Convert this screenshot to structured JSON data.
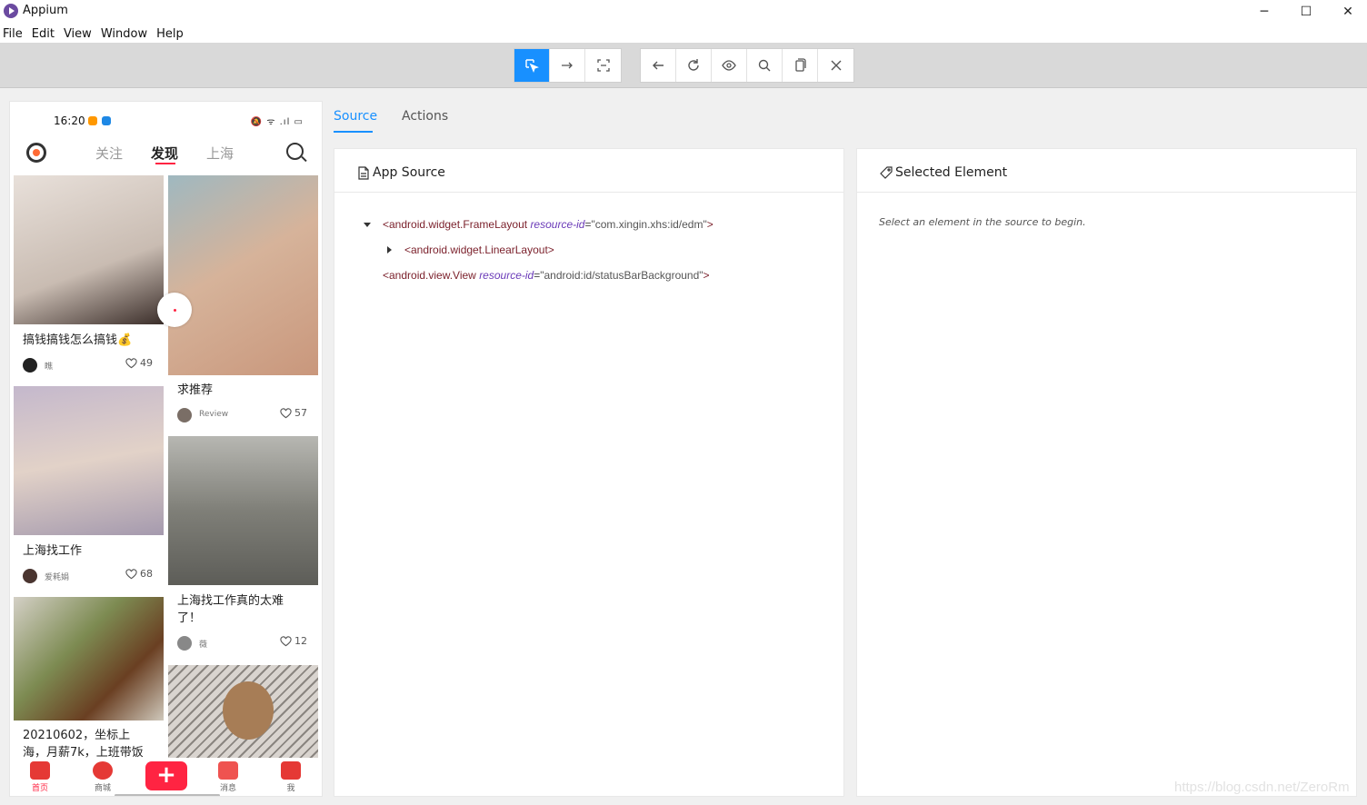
{
  "window": {
    "title": "Appium",
    "controls": [
      "─",
      "☐",
      "✕"
    ]
  },
  "menu": [
    "File",
    "Edit",
    "View",
    "Window",
    "Help"
  ],
  "toolbar": {
    "group1": [
      {
        "icon": "select-cursor-icon",
        "active": true
      },
      {
        "icon": "swipe-arrow-icon",
        "active": false
      },
      {
        "icon": "tap-area-icon",
        "active": false
      }
    ],
    "group2": [
      {
        "icon": "back-arrow-icon"
      },
      {
        "icon": "refresh-icon"
      },
      {
        "icon": "eye-icon"
      },
      {
        "icon": "search-icon"
      },
      {
        "icon": "copy-icon"
      },
      {
        "icon": "close-icon"
      }
    ]
  },
  "phone": {
    "status_time": "16:20",
    "status_dot_colors": [
      "#ff9800",
      "#1e88e5"
    ],
    "status_icons": "🔕 ᯤ .ıl ▭",
    "tabs": [
      "关注",
      "发现",
      "上海"
    ],
    "active_tab": "发现",
    "cards": [
      {
        "title": "搞钱搞钱怎么搞钱💰",
        "author": "瞧",
        "likes": "49",
        "image_color": "#d9cfc8",
        "avatar_color": "#222"
      },
      {
        "title": "求推荐",
        "author": "Review",
        "likes": "57",
        "image_color": "#c9a58b",
        "avatar_color": "#7a6e66"
      },
      {
        "title": "上海找工作",
        "author": "爱耗娟",
        "likes": "68",
        "image_color": "#a79fb0",
        "avatar_color": "#4a3530"
      },
      {
        "title": "上海找工作真的太难了！",
        "title_line1": "上海找工作真的太难",
        "title_line2": "了！",
        "author": "薇",
        "likes": "12",
        "image_color": "#8a8880",
        "avatar_color": "#888"
      },
      {
        "title": "20210602，坐标上海，月薪7k，上班带饭",
        "title_line1": "20210602，坐标上",
        "title_line2": "海，月薪7k，上班带饭",
        "image_color": "#7d8b52"
      },
      {
        "title": "",
        "image_color": "#cbc2b8"
      }
    ],
    "bottom_nav": [
      {
        "label": "首页",
        "icon": "home-icon",
        "active": true,
        "color": "#e53935"
      },
      {
        "label": "商城",
        "icon": "shop-icon",
        "active": false,
        "color": "#e53935"
      },
      {
        "label": "+",
        "icon": "plus-icon"
      },
      {
        "label": "消息",
        "icon": "message-icon",
        "active": false,
        "color": "#ef5350"
      },
      {
        "label": "我",
        "icon": "profile-icon",
        "active": false,
        "color": "#e53935"
      }
    ]
  },
  "inspector": {
    "tabs": [
      "Source",
      "Actions"
    ],
    "active_tab": "Source",
    "source_panel": {
      "title": "App Source",
      "tree": [
        {
          "tag_open": "<android.widget.FrameLayout",
          "attr": "resource-id",
          "value": "\"com.xingin.xhs:id/edm\"",
          "tag_close": ">",
          "expanded": true
        },
        {
          "tag_open": "<android.widget.LinearLayout",
          "attr": "",
          "value": "",
          "tag_close": ">",
          "expanded": false
        },
        {
          "tag_open": "<android.view.View",
          "attr": "resource-id",
          "value": "\"android:id/statusBarBackground\"",
          "tag_close": ">",
          "expanded": null
        }
      ]
    },
    "selected_panel": {
      "title": "Selected Element",
      "hint": "Select an element in the source to begin."
    }
  },
  "watermark": "https://blog.csdn.net/ZeroRm"
}
